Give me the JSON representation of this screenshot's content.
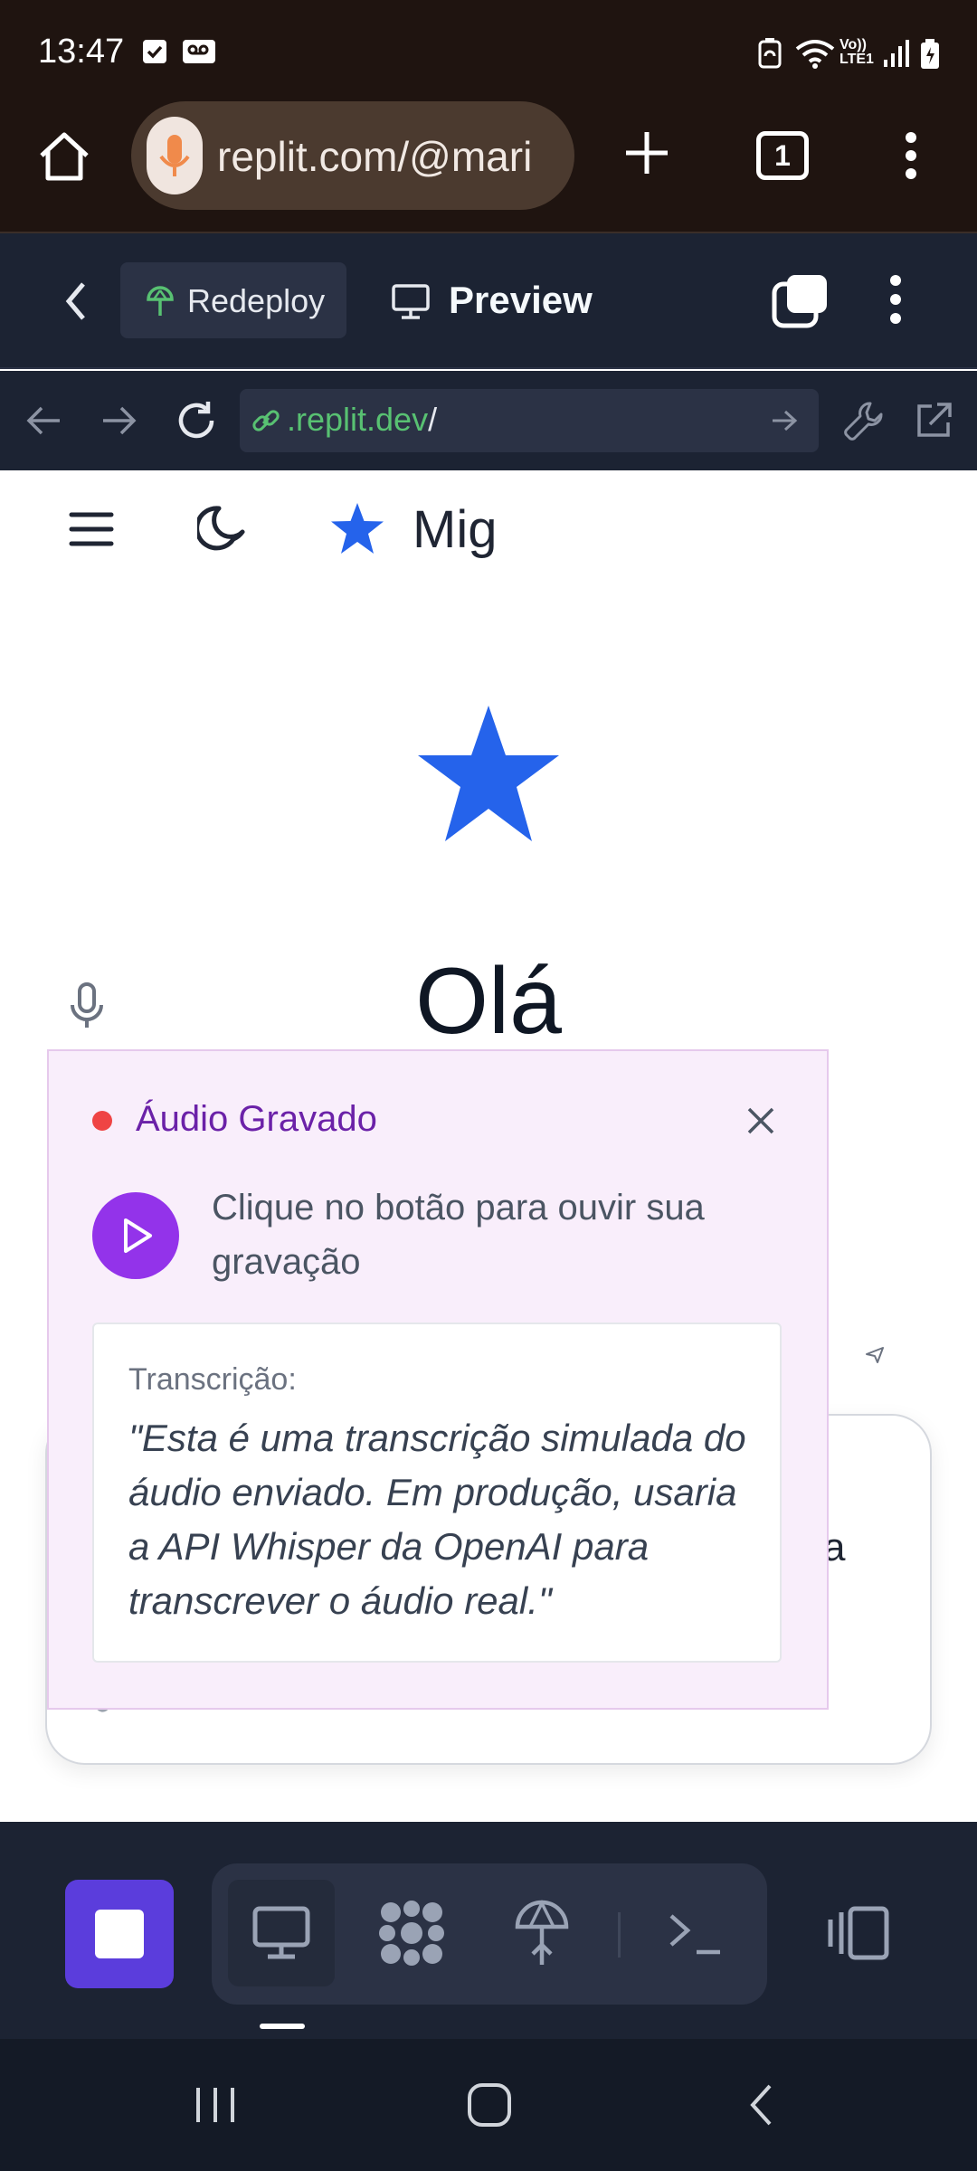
{
  "status_bar": {
    "time": "13:47"
  },
  "browser": {
    "url_text": "replit.com/@mari",
    "tab_count": "1"
  },
  "replit_toolbar": {
    "redeploy_label": "Redeploy",
    "preview_label": "Preview"
  },
  "preview_nav": {
    "address_main": ".replit.dev",
    "address_suffix": "/"
  },
  "app": {
    "title": "Mig",
    "greeting": "Olá",
    "chat_fragment": "a"
  },
  "audio_popup": {
    "title": "Áudio Gravado",
    "description": "Clique no botão para ouvir sua gravação",
    "transcription_label": "Transcrição:",
    "transcription_text": "\"Esta é uma transcrição simulada do áudio enviado. Em produção, usaria a API Whisper da OpenAI para transcrever o áudio real.\""
  },
  "colors": {
    "accent_blue": "#2563eb",
    "purple": "#9333ea",
    "recording_red": "#ef4444"
  }
}
